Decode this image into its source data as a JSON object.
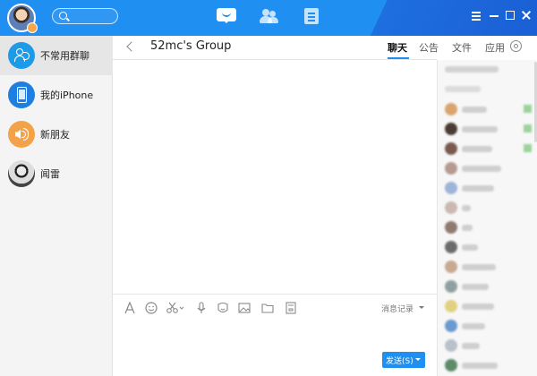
{
  "header": {
    "nav": [
      {
        "name": "chat",
        "active": true
      },
      {
        "name": "contacts",
        "active": false
      },
      {
        "name": "apps",
        "active": false
      }
    ],
    "window_controls": [
      "menu-icon",
      "minimize-icon",
      "maximize-icon",
      "close-icon"
    ]
  },
  "sidebar": {
    "items": [
      {
        "label": "不常用群聊",
        "icon": "group-icon",
        "active": true
      },
      {
        "label": "我的iPhone",
        "icon": "phone-icon",
        "active": false
      },
      {
        "label": "新朋友",
        "icon": "speaker-icon",
        "active": false
      },
      {
        "label": "闻雷",
        "icon": "avatar",
        "active": false
      }
    ]
  },
  "chat": {
    "title": "52mc's Group",
    "tabs": [
      {
        "label": "聊天",
        "active": true
      },
      {
        "label": "公告",
        "active": false
      },
      {
        "label": "文件",
        "active": false
      },
      {
        "label": "应用",
        "active": false
      }
    ],
    "toolbar": {
      "tools": [
        "font-icon",
        "emoji-icon",
        "scissors-icon",
        "microphone-icon",
        "sticker-icon",
        "image-icon",
        "folder-icon",
        "archive-icon"
      ],
      "history_label": "消息记录"
    },
    "send_label": "发送(S)"
  },
  "colors": {
    "brand": "#1f8ff2",
    "sidebar_bg": "#f4f4f4",
    "member_panel_bg": "#f7f7f7"
  }
}
